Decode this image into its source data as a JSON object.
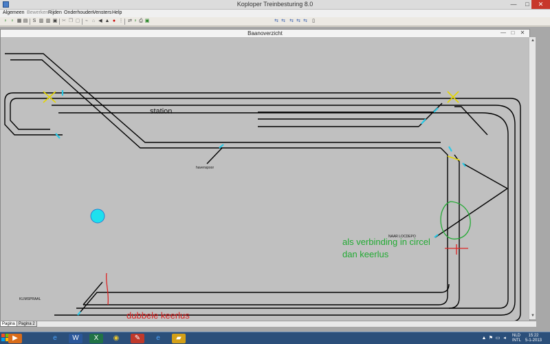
{
  "app": {
    "title": "Koploper Treinbesturing 8.0",
    "min": "—",
    "max": "□",
    "close": "✕"
  },
  "menu": [
    {
      "label": "Algemeen",
      "enabled": true
    },
    {
      "label": "Bewerken",
      "enabled": false
    },
    {
      "label": "Rijden",
      "enabled": true
    },
    {
      "label": "Onderhouden",
      "enabled": true
    },
    {
      "label": "Vensters",
      "enabled": true
    },
    {
      "label": "Help",
      "enabled": true
    }
  ],
  "toolbar_icons": [
    "signal-icon",
    "signal-icon",
    "grid-icon",
    "arrow-icon",
    "s-icon",
    "table-icon",
    "table-icon",
    "table-icon",
    "tools-icon",
    "cut-icon",
    "copy-icon",
    "turnout-icon",
    "lock-icon",
    "sound-icon",
    "train-icon",
    "stop-icon",
    "route-icon",
    "switch-icon",
    "print-icon",
    "export-icon",
    "switch-a-icon",
    "switch-b-icon",
    "switch-c-icon",
    "switch-d-icon",
    "page-icon"
  ],
  "child": {
    "title": "Baanoverzicht",
    "min": "—",
    "max": "□",
    "close": "✕"
  },
  "canvas": {
    "station": "station",
    "havenspoor": "havenspoor",
    "naar_locdepo": "NAAR LOCDEPO",
    "klimspraal": "KLIMSPRAAL",
    "note_green_line1": "als verbinding in circel",
    "note_green_line2": "dan keerlus",
    "note_red": "dubbele keerlus"
  },
  "colors": {
    "track": "#000000",
    "marker": "#29c9e6",
    "turnout": "#e4d600",
    "note_green": "#22aa33",
    "note_red": "#dd2222",
    "blue_dot": "#1ee0ee"
  },
  "page_tabs": [
    "Pagina 1",
    "Pagina 2"
  ],
  "scroll": {
    "up": "▲",
    "down": "▼"
  },
  "taskbar": {
    "icons": [
      "start-icon",
      "media-player-icon",
      "internet-explorer-icon",
      "word-icon",
      "excel-icon",
      "chrome-icon",
      "paint-icon",
      "internet-explorer-icon",
      "koploper-icon"
    ],
    "lang": [
      "NLD",
      "INTL"
    ],
    "time": "15:22",
    "date": "5-1-2013"
  }
}
